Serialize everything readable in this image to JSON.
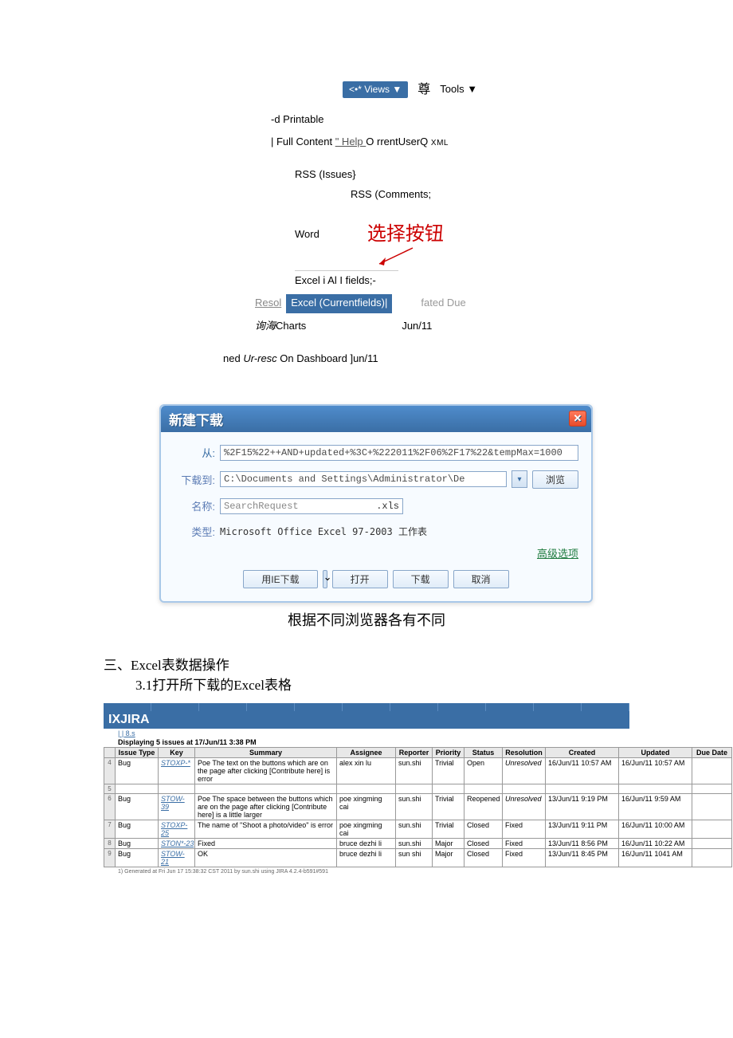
{
  "views": {
    "views_btn": "<•* Views ▼",
    "zun": "尊",
    "tools": "Tools ▼",
    "printable": "-d Printable",
    "full_content_prefix": "| Full Content ",
    "help_link": "\" Help ",
    "full_content_suffix": "O rrentUserQ ",
    "xml": "XML",
    "rss_issues": "RSS (Issues}",
    "rss_comments": "RSS (Comments;",
    "word": "Word",
    "red_label": "选择按钮",
    "excel_all": "Excel i Al I fields;-",
    "resol": "Resol",
    "excel_current": "Excel (Currentfields)|",
    "fated_due": "fated Due",
    "charts_prefix": "询海",
    "charts": "Charts",
    "jun11": "Jun/11",
    "ned_line_prefix": "ned ",
    "ned_line_em": "Ur-resc",
    "ned_line_suffix": " On Dashboard ]un/11"
  },
  "dialog": {
    "title": "新建下载",
    "from_label": "从:",
    "from_value": "%2F15%22++AND+updated+%3C+%222011%2F06%2F17%22&tempMax=1000",
    "to_label": "下载到:",
    "to_value": "C:\\Documents and Settings\\Administrator\\De",
    "browse": "浏览",
    "name_label": "名称:",
    "name_value": "SearchRequest",
    "name_ext": ".xls",
    "type_label": "类型:",
    "type_value": "Microsoft Office Excel 97-2003 工作表",
    "advanced": "高级选项",
    "ie_download": "用IE下载",
    "open": "打开",
    "download": "下载",
    "cancel": "取消"
  },
  "caption": "根据不同浏览器各有不同",
  "section": {
    "l1": "三、Excel表数据操作",
    "l2": "3.1打开所下载的Excel表格"
  },
  "excel": {
    "title": "IXJIRA",
    "sub": "| | 8.s",
    "displaying": "Displaying 5 issues at 17/Jun/11 3:38 PM",
    "headers": [
      "Issue Type",
      "Key",
      "Summary",
      "Assignee",
      "Reporter",
      "Priority",
      "Status",
      "Resolution",
      "Created",
      "Updated",
      "Due Date"
    ],
    "rows": [
      {
        "n": "4",
        "type": "Bug",
        "key": "STOXP-*",
        "sum": "Poe The text on the buttons which are on the page after clicking [Contribute here] is error",
        "asg": "alex xin lu",
        "rep": "sun.shi",
        "pri": "Trivial",
        "sta": "Open",
        "res": "Unresolved",
        "cre": "16/Jun/11 10:57 AM",
        "upd": "16/Jun/11 10:57 AM",
        "due": ""
      },
      {
        "n": "5",
        "type": "",
        "key": "",
        "sum": "",
        "asg": "",
        "rep": "",
        "pri": "",
        "sta": "",
        "res": "",
        "cre": "",
        "upd": "",
        "due": ""
      },
      {
        "n": "6",
        "type": "Bug",
        "key": "STOW-39",
        "sum": "Poe The space between the buttons which are on the page after clicking [Contribute here] is a little larger",
        "asg": "poe xingming cai",
        "rep": "sun.shi",
        "pri": "Trivial",
        "sta": "Reopened",
        "res": "Unresolved",
        "cre": "13/Jun/11 9:19 PM",
        "upd": "16/Jun/11 9:59 AM",
        "due": ""
      },
      {
        "n": "7",
        "type": "Bug",
        "key": "STOXP-25",
        "sum": "The name of \"Shoot a photo/video\" is error",
        "asg": "poe xingming cai",
        "rep": "sun.shi",
        "pri": "Trivial",
        "sta": "Closed",
        "res": "Fixed",
        "cre": "13/Jun/11 9:11 PM",
        "upd": "16/Jun/11 10:00 AM",
        "due": ""
      },
      {
        "n": "8",
        "type": "Bug",
        "key": "STON*-23",
        "sum": "Fixed",
        "asg": "bruce dezhi li",
        "rep": "sun.shi",
        "pri": "Major",
        "sta": "Closed",
        "res": "Fixed",
        "cre": "13/Jun/11 8:56 PM",
        "upd": "16/Jun/11 10:22 AM",
        "due": ""
      },
      {
        "n": "9",
        "type": "Bug",
        "key": "STOW-21",
        "sum": "OK",
        "asg": "bruce dezhi li",
        "rep": "sun shi",
        "pri": "Major",
        "sta": "Closed",
        "res": "Fixed",
        "cre": "13/Jun/11 8:45 PM",
        "upd": "16/Jun/11 1041 AM",
        "due": ""
      }
    ],
    "footer": "1) Generated at Fri Jun 17 15:38:32 CST 2011 by sun.shi using JIRA 4.2.4-b591#591"
  }
}
